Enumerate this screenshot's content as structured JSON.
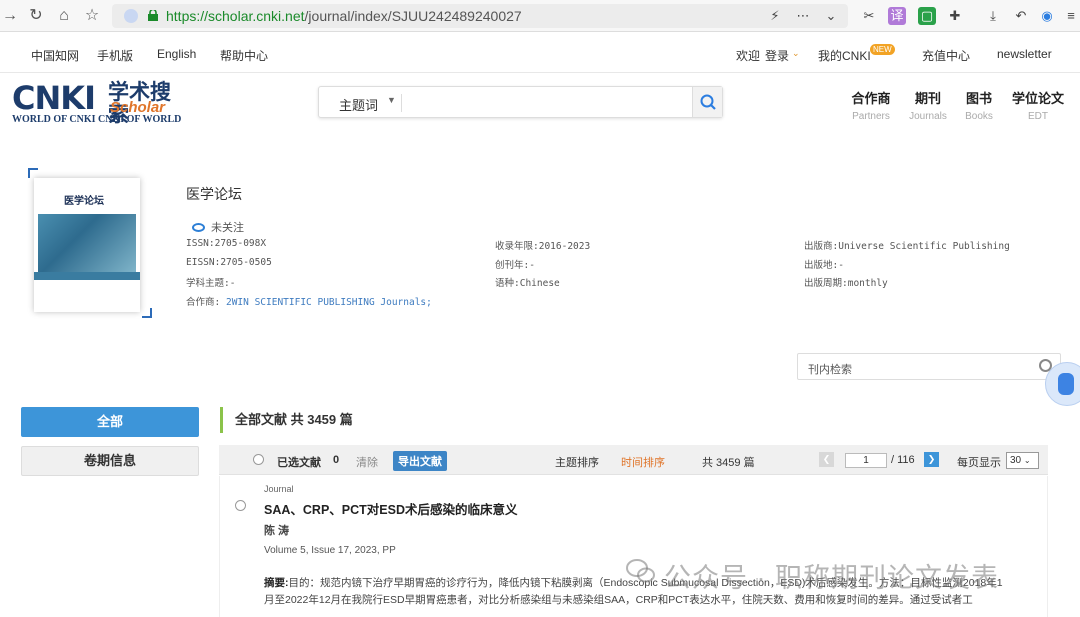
{
  "browser": {
    "url_host": "https://scholar.cnki.net",
    "url_path": "/journal/index/SJUU242489240027"
  },
  "topnav": {
    "left": [
      "中国知网",
      "手机版",
      "English",
      "帮助中心"
    ],
    "welcome": "欢迎",
    "login": "登录",
    "my_cnki": "我的CNKI",
    "new_badge": "NEW",
    "recharge": "充值中心",
    "newsletter": "newsletter"
  },
  "logo": {
    "main": "CNKI",
    "cn": "学术搜索",
    "scholar": "Scholar",
    "sub": "WORLD OF CNKI CNKI OF WORLD"
  },
  "search": {
    "field": "主题词"
  },
  "partners": [
    {
      "title": "合作商",
      "sub": "Partners"
    },
    {
      "title": "期刊",
      "sub": "Journals"
    },
    {
      "title": "图书",
      "sub": "Books"
    },
    {
      "title": "学位论文",
      "sub": "EDT"
    }
  ],
  "journal": {
    "cover_title": "医学论坛",
    "title": "医学论坛",
    "follow": "未关注",
    "issn": "ISSN:2705-098X",
    "eissn": "EISSN:2705-0505",
    "subject": "学科主题:-",
    "partner_label": "合作商:",
    "partner_link": "2WIN SCIENTIFIC PUBLISHING Journals;",
    "years": "收录年限:2016-2023",
    "founded": "创刊年:-",
    "language": "语种:Chinese",
    "publisher": "出版商:Universe Scientific Publishing",
    "place": "出版地:-",
    "cycle": "出版周期:monthly"
  },
  "inner_search": {
    "placeholder": "刊内检索"
  },
  "sidebar": {
    "all": "全部",
    "volumes": "卷期信息"
  },
  "results": {
    "heading": "全部文献 共 3459 篇",
    "selected_label": "已选文献",
    "selected_count": "0",
    "clear": "清除",
    "export": "导出文献",
    "sort_subject": "主题排序",
    "sort_time": "时间排序",
    "total": "共 3459 篇",
    "page_current": "1",
    "page_total": "/ 116",
    "per_page_label": "每页显示",
    "per_page": "30"
  },
  "article": {
    "type": "Journal",
    "title": "SAA、CRP、PCT对ESD术后感染的临床意义",
    "author": "陈 涛",
    "volume": "Volume 5, Issue 17, 2023, PP",
    "abstract_label": "摘要:",
    "abstract": "目的：规范内镜下治疗早期胃癌的诊疗行为，降低内镜下粘膜剥离（Endoscopic Submucosal Dissection，ESD)术后感染发生。方法：目标性监测2018年1月至2022年12月在我院行ESD早期胃癌患者，对比分析感染组与未感染组SAA，CRP和PCT表达水平，住院天数、费用和恢复时间的差异。通过受试者工"
  },
  "watermark": "公众号 · 职称期刊论文发表",
  "colors": {
    "accent": "#3d95d9",
    "orange": "#e0752a",
    "green_bar": "#8bc34a"
  }
}
